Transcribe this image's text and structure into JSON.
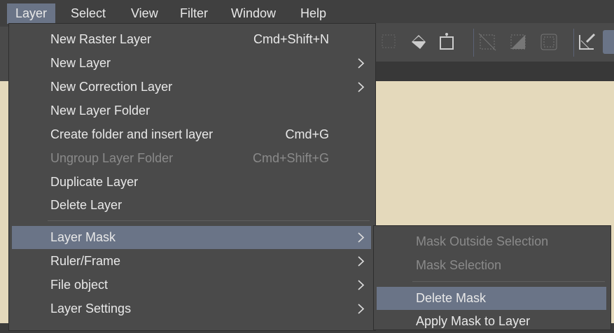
{
  "menubar": {
    "items": [
      "Layer",
      "Select",
      "View",
      "Filter",
      "Window",
      "Help"
    ],
    "active": "Layer"
  },
  "toolbar": {
    "icons": [
      "transform-selection-icon",
      "fill-icon",
      "resize-icon",
      "clear-selection-icon",
      "invert-selection-icon",
      "expand-selection-icon",
      "ruler-icon",
      "mask-icon"
    ]
  },
  "layer_menu": {
    "items": [
      {
        "label": "New Raster Layer",
        "shortcut": "Cmd+Shift+N"
      },
      {
        "label": "New Layer",
        "submenu": true
      },
      {
        "label": "New Correction Layer",
        "submenu": true
      },
      {
        "label": "New Layer Folder"
      },
      {
        "label": "Create folder and insert layer",
        "shortcut": "Cmd+G"
      },
      {
        "label": "Ungroup Layer Folder",
        "shortcut": "Cmd+Shift+G",
        "disabled": true
      },
      {
        "label": "Duplicate Layer"
      },
      {
        "label": "Delete Layer"
      },
      {
        "label": "Layer Mask",
        "submenu": true,
        "highlighted": true
      },
      {
        "label": "Ruler/Frame",
        "submenu": true
      },
      {
        "label": "File object",
        "submenu": true
      },
      {
        "label": "Layer Settings",
        "submenu": true
      }
    ]
  },
  "layer_mask_submenu": {
    "items": [
      {
        "label": "Mask Outside Selection",
        "disabled": true
      },
      {
        "label": "Mask Selection",
        "disabled": true
      },
      {
        "label": "Delete Mask",
        "highlighted": true
      },
      {
        "label": "Apply Mask to Layer"
      }
    ]
  },
  "colors": {
    "highlight": "#6a7487",
    "menu_bg": "#4a4a4a",
    "canvas": "#e4d9bb"
  }
}
